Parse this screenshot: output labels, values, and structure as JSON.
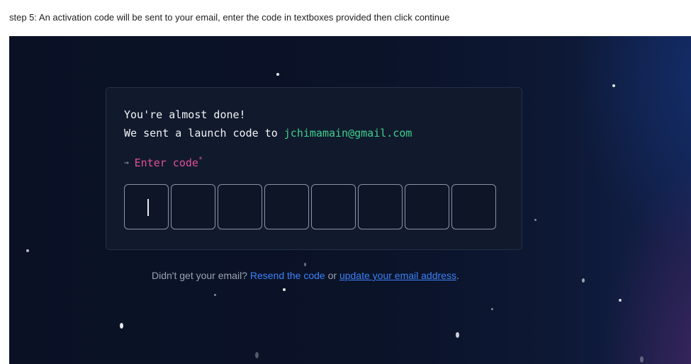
{
  "caption": "step 5: An activation code will be sent to your email, enter the code in textboxes provided then click continue",
  "card": {
    "heading": "You're almost done!",
    "sent_prefix": "We sent a launch code to ",
    "email": "jchimamain@gmail.com",
    "enter_label": "Enter code",
    "required_mark": "*",
    "arrow_icon": "→",
    "code_boxes": [
      "",
      "",
      "",
      "",
      "",
      "",
      "",
      ""
    ]
  },
  "helper": {
    "prefix": "Didn't get your email? ",
    "resend_label": "Resend the code",
    "middle": " or ",
    "update_label": "update your email address",
    "suffix": "."
  },
  "colors": {
    "accent_email": "#3fcf8e",
    "accent_label": "#e04e9d",
    "link": "#3b82f6",
    "background": "#0b1329",
    "card": "#111a2c"
  }
}
